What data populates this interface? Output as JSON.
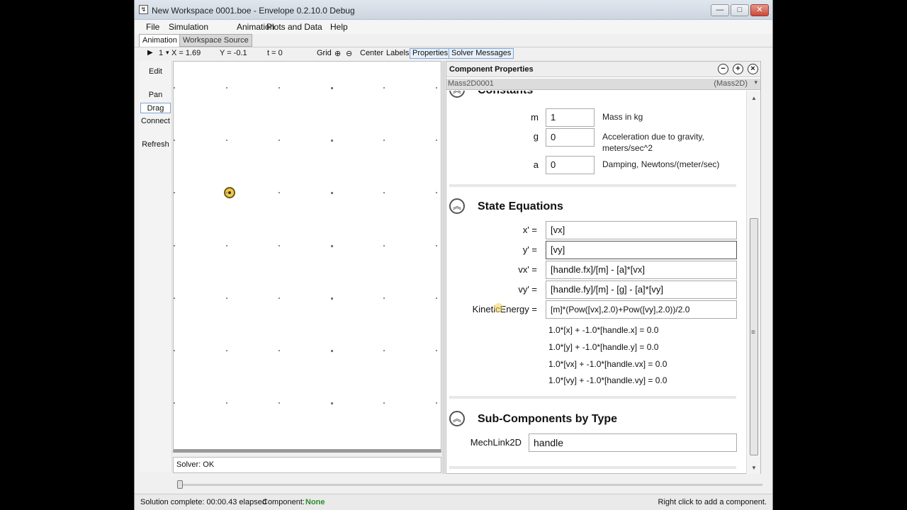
{
  "window": {
    "title": "New Workspace 0001.boe - Envelope 0.2.10.0 Debug",
    "controls": {
      "minimize": "—",
      "maximize": "□",
      "close": "✕"
    }
  },
  "menu": [
    "File",
    "Simulation",
    "Animation",
    "Plots and Data",
    "Help"
  ],
  "tabs": {
    "animation": "Animation",
    "workspace_source": "Workspace Source"
  },
  "status_line": {
    "frame": "1",
    "x": "X = 1.69",
    "y": "Y = -0.1",
    "t": "t = 0",
    "grid": "Grid",
    "center": "Center",
    "labels": "Labels",
    "properties": "Properties",
    "solver_messages": "Solver Messages"
  },
  "tools": {
    "edit": "Edit",
    "pan": "Pan",
    "drag": "Drag",
    "connect": "Connect",
    "refresh": "Refresh"
  },
  "solver_status": "Solver: OK",
  "props": {
    "title": "Component Properties",
    "component_name": "Mass2D0001",
    "component_type": "(Mass2D)",
    "sections": {
      "constants": "Constants",
      "state_equations": "State Equations",
      "sub_components": "Sub-Components by Type"
    },
    "constants": [
      {
        "name": "m",
        "value": "1",
        "desc": "Mass in kg"
      },
      {
        "name": "g",
        "value": "0",
        "desc": "Acceleration due to gravity, meters/sec^2"
      },
      {
        "name": "a",
        "value": "0",
        "desc": "Damping, Newtons/(meter/sec)"
      }
    ],
    "equations": [
      {
        "label": "x' =",
        "value": "[vx]"
      },
      {
        "label": "y' =",
        "value": "[vy]"
      },
      {
        "label": "vx' =",
        "value": "[handle.fx]/[m] - [a]*[vx]"
      },
      {
        "label": "vy' =",
        "value": "[handle.fy]/[m] - [g] - [a]*[vy]"
      },
      {
        "label": "KineticEnergy =",
        "value": "[m]*(Pow([vx],2.0)+Pow([vy],2.0))/2.0"
      }
    ],
    "constraints": [
      "1.0*[x] + -1.0*[handle.x] = 0.0",
      "1.0*[y] + -1.0*[handle.y] = 0.0",
      "1.0*[vx] + -1.0*[handle.vx] = 0.0",
      "1.0*[vy] + -1.0*[handle.vy] = 0.0"
    ],
    "sub_components": [
      {
        "type": "MechLink2D",
        "value": "handle"
      }
    ]
  },
  "statusbar": {
    "elapsed": "Solution complete: 00:00.43 elapsed",
    "component_label": "Component:",
    "component_value": "None",
    "hint": "Right click to add a component."
  }
}
